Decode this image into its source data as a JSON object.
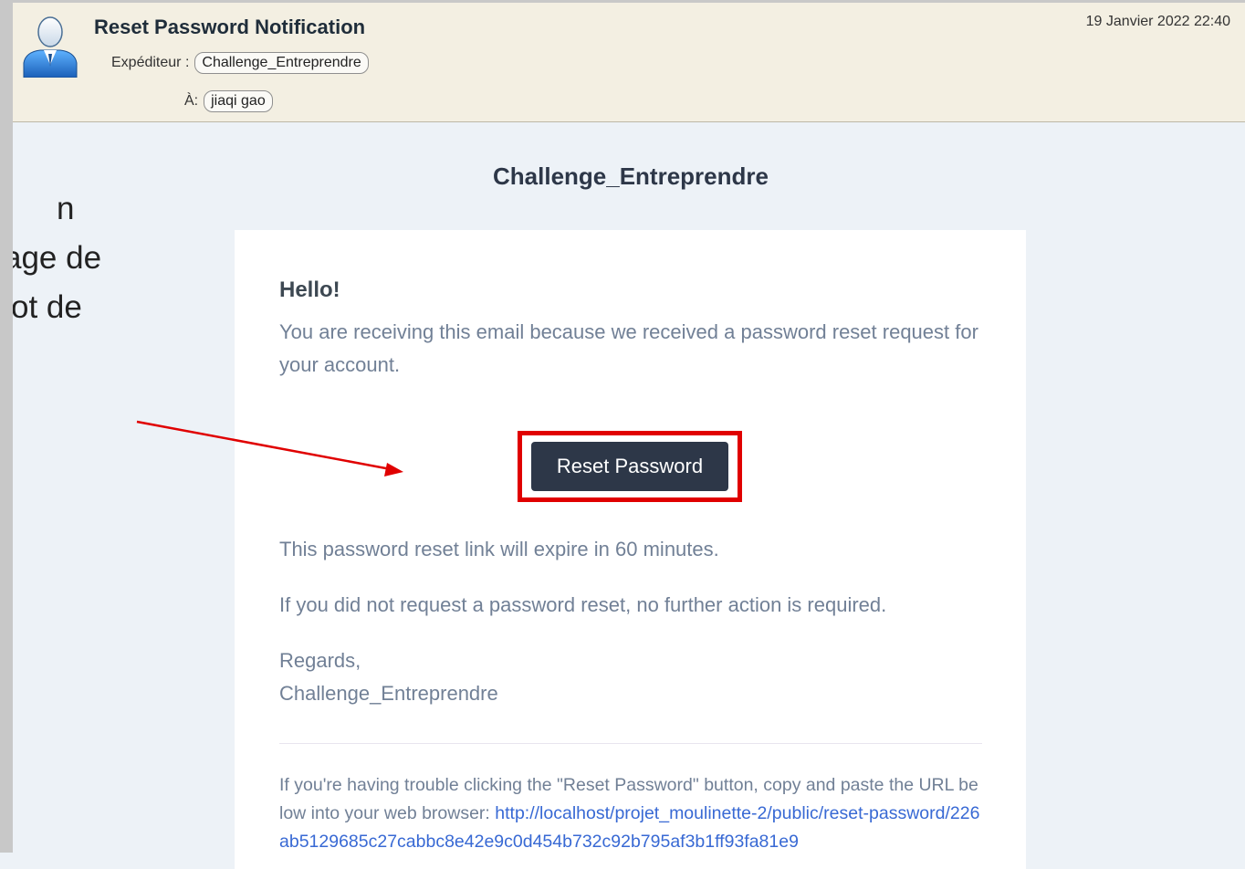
{
  "email": {
    "subject": "Reset Password Notification",
    "date": "19 Janvier 2022 22:40",
    "from_label": "Expéditeur :",
    "from_value": "Challenge_Entreprendre",
    "to_label": "À:",
    "to_value": "jiaqi gao"
  },
  "side_note": {
    "lines": [
      "n",
      "age de",
      "ot de"
    ]
  },
  "body": {
    "brand": "Challenge_Entreprendre",
    "greeting": "Hello!",
    "intro": "You are receiving this email because we received a password reset request for your account.",
    "button_label": "Reset Password",
    "expire": "This password reset link will expire in 60 minutes.",
    "no_action": "If you did not request a password reset, no further action is required.",
    "regards": "Regards,",
    "signature": "Challenge_Entreprendre",
    "trouble": "If you're having trouble clicking the \"Reset Password\" button, copy and paste the URL below into your web browser:",
    "url": "http://localhost/projet_moulinette-2/public/reset-password/226ab5129685c27cabbc8e42e9c0d454b732c92b795af3b1ff93fa81e9"
  },
  "colors": {
    "annotation": "#e00000",
    "button": "#2d3748",
    "link": "#3869d4"
  },
  "icons": {
    "avatar": "user-avatar-icon",
    "arrow": "annotation-arrow"
  }
}
